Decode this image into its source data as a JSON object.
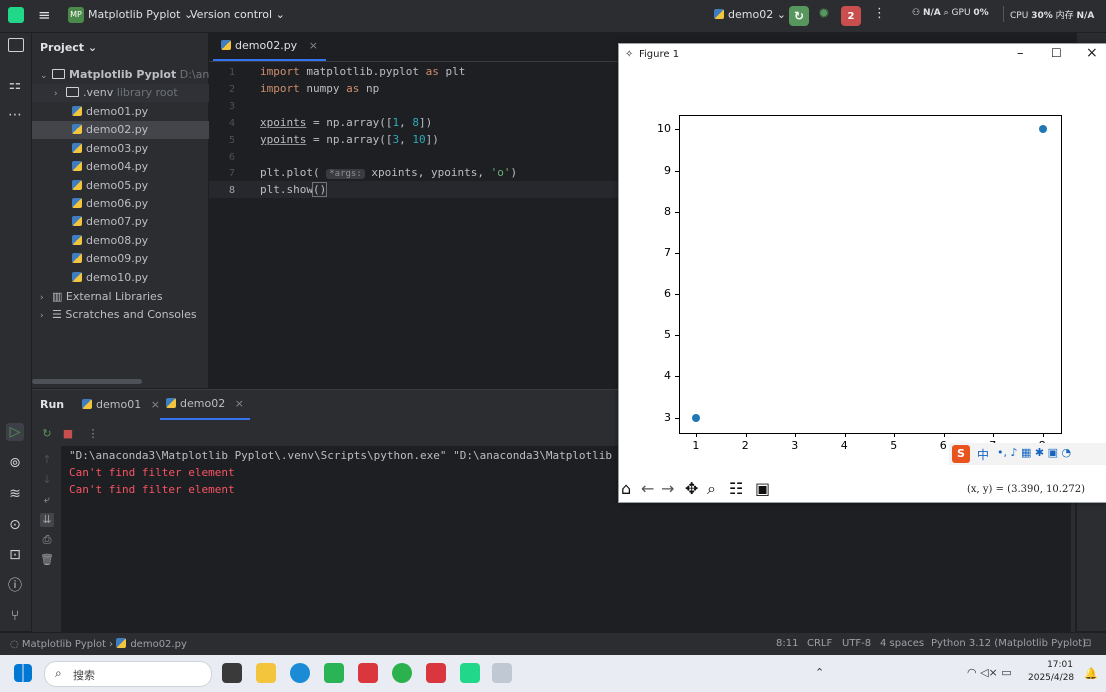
{
  "topbar": {
    "project_badge": "MP",
    "project_name": "Matplotlib Pyplot",
    "vcs": "Version control",
    "run_config": "demo02",
    "stop_count": "2",
    "gpu_status": "N/A",
    "gpu_label": "GPU",
    "gpu_pct": "0%",
    "cpu_label": "CPU",
    "cpu_pct": "30%",
    "mem_label": "内存",
    "mem_value": "N/A"
  },
  "project": {
    "title": "Project",
    "root_name": "Matplotlib Pyplot",
    "root_path": "D:\\anaconda",
    "venv": ".venv",
    "venv_note": "library root",
    "files": [
      "demo01.py",
      "demo02.py",
      "demo03.py",
      "demo04.py",
      "demo05.py",
      "demo06.py",
      "demo07.py",
      "demo08.py",
      "demo09.py",
      "demo10.py"
    ],
    "external": "External Libraries",
    "scratches": "Scratches and Consoles"
  },
  "editor": {
    "tab": "demo02.py",
    "line_numbers": [
      "1",
      "2",
      "3",
      "4",
      "5",
      "6",
      "7",
      "8"
    ],
    "hint": "*args:"
  },
  "run": {
    "title": "Run",
    "tab1": "demo01",
    "tab2": "demo02",
    "cmd": "\"D:\\anaconda3\\Matplotlib Pyplot\\.venv\\Scripts\\python.exe\" \"D:\\anaconda3\\Matplotlib Pyplot",
    "err1": "Can't find filter element",
    "err2": "Can't find filter element"
  },
  "status": {
    "crumb1": "Matplotlib Pyplot",
    "crumb2": "demo02.py",
    "position": "8:11",
    "line_sep": "CRLF",
    "encoding": "UTF-8",
    "indent": "4 spaces",
    "interpreter": "Python 3.12 (Matplotlib Pyplot)"
  },
  "taskbar": {
    "search_placeholder": "搜索",
    "time": "17:01",
    "date": "2025/4/28"
  },
  "figure": {
    "title": "Figure 1",
    "coords": "(x, y) = (3.390, 10.272)",
    "ime_chars": "中"
  },
  "chart_data": {
    "type": "scatter",
    "x": [
      1,
      8
    ],
    "y": [
      3,
      10
    ],
    "xticks": [
      "1",
      "2",
      "3",
      "4",
      "5",
      "6",
      "7",
      "8"
    ],
    "yticks": [
      "3",
      "4",
      "5",
      "6",
      "7",
      "8",
      "9",
      "10"
    ],
    "xlim": [
      0.65,
      8.35
    ],
    "ylim": [
      2.65,
      10.35
    ],
    "marker": "o",
    "color": "#1f77b4",
    "grid": false
  }
}
